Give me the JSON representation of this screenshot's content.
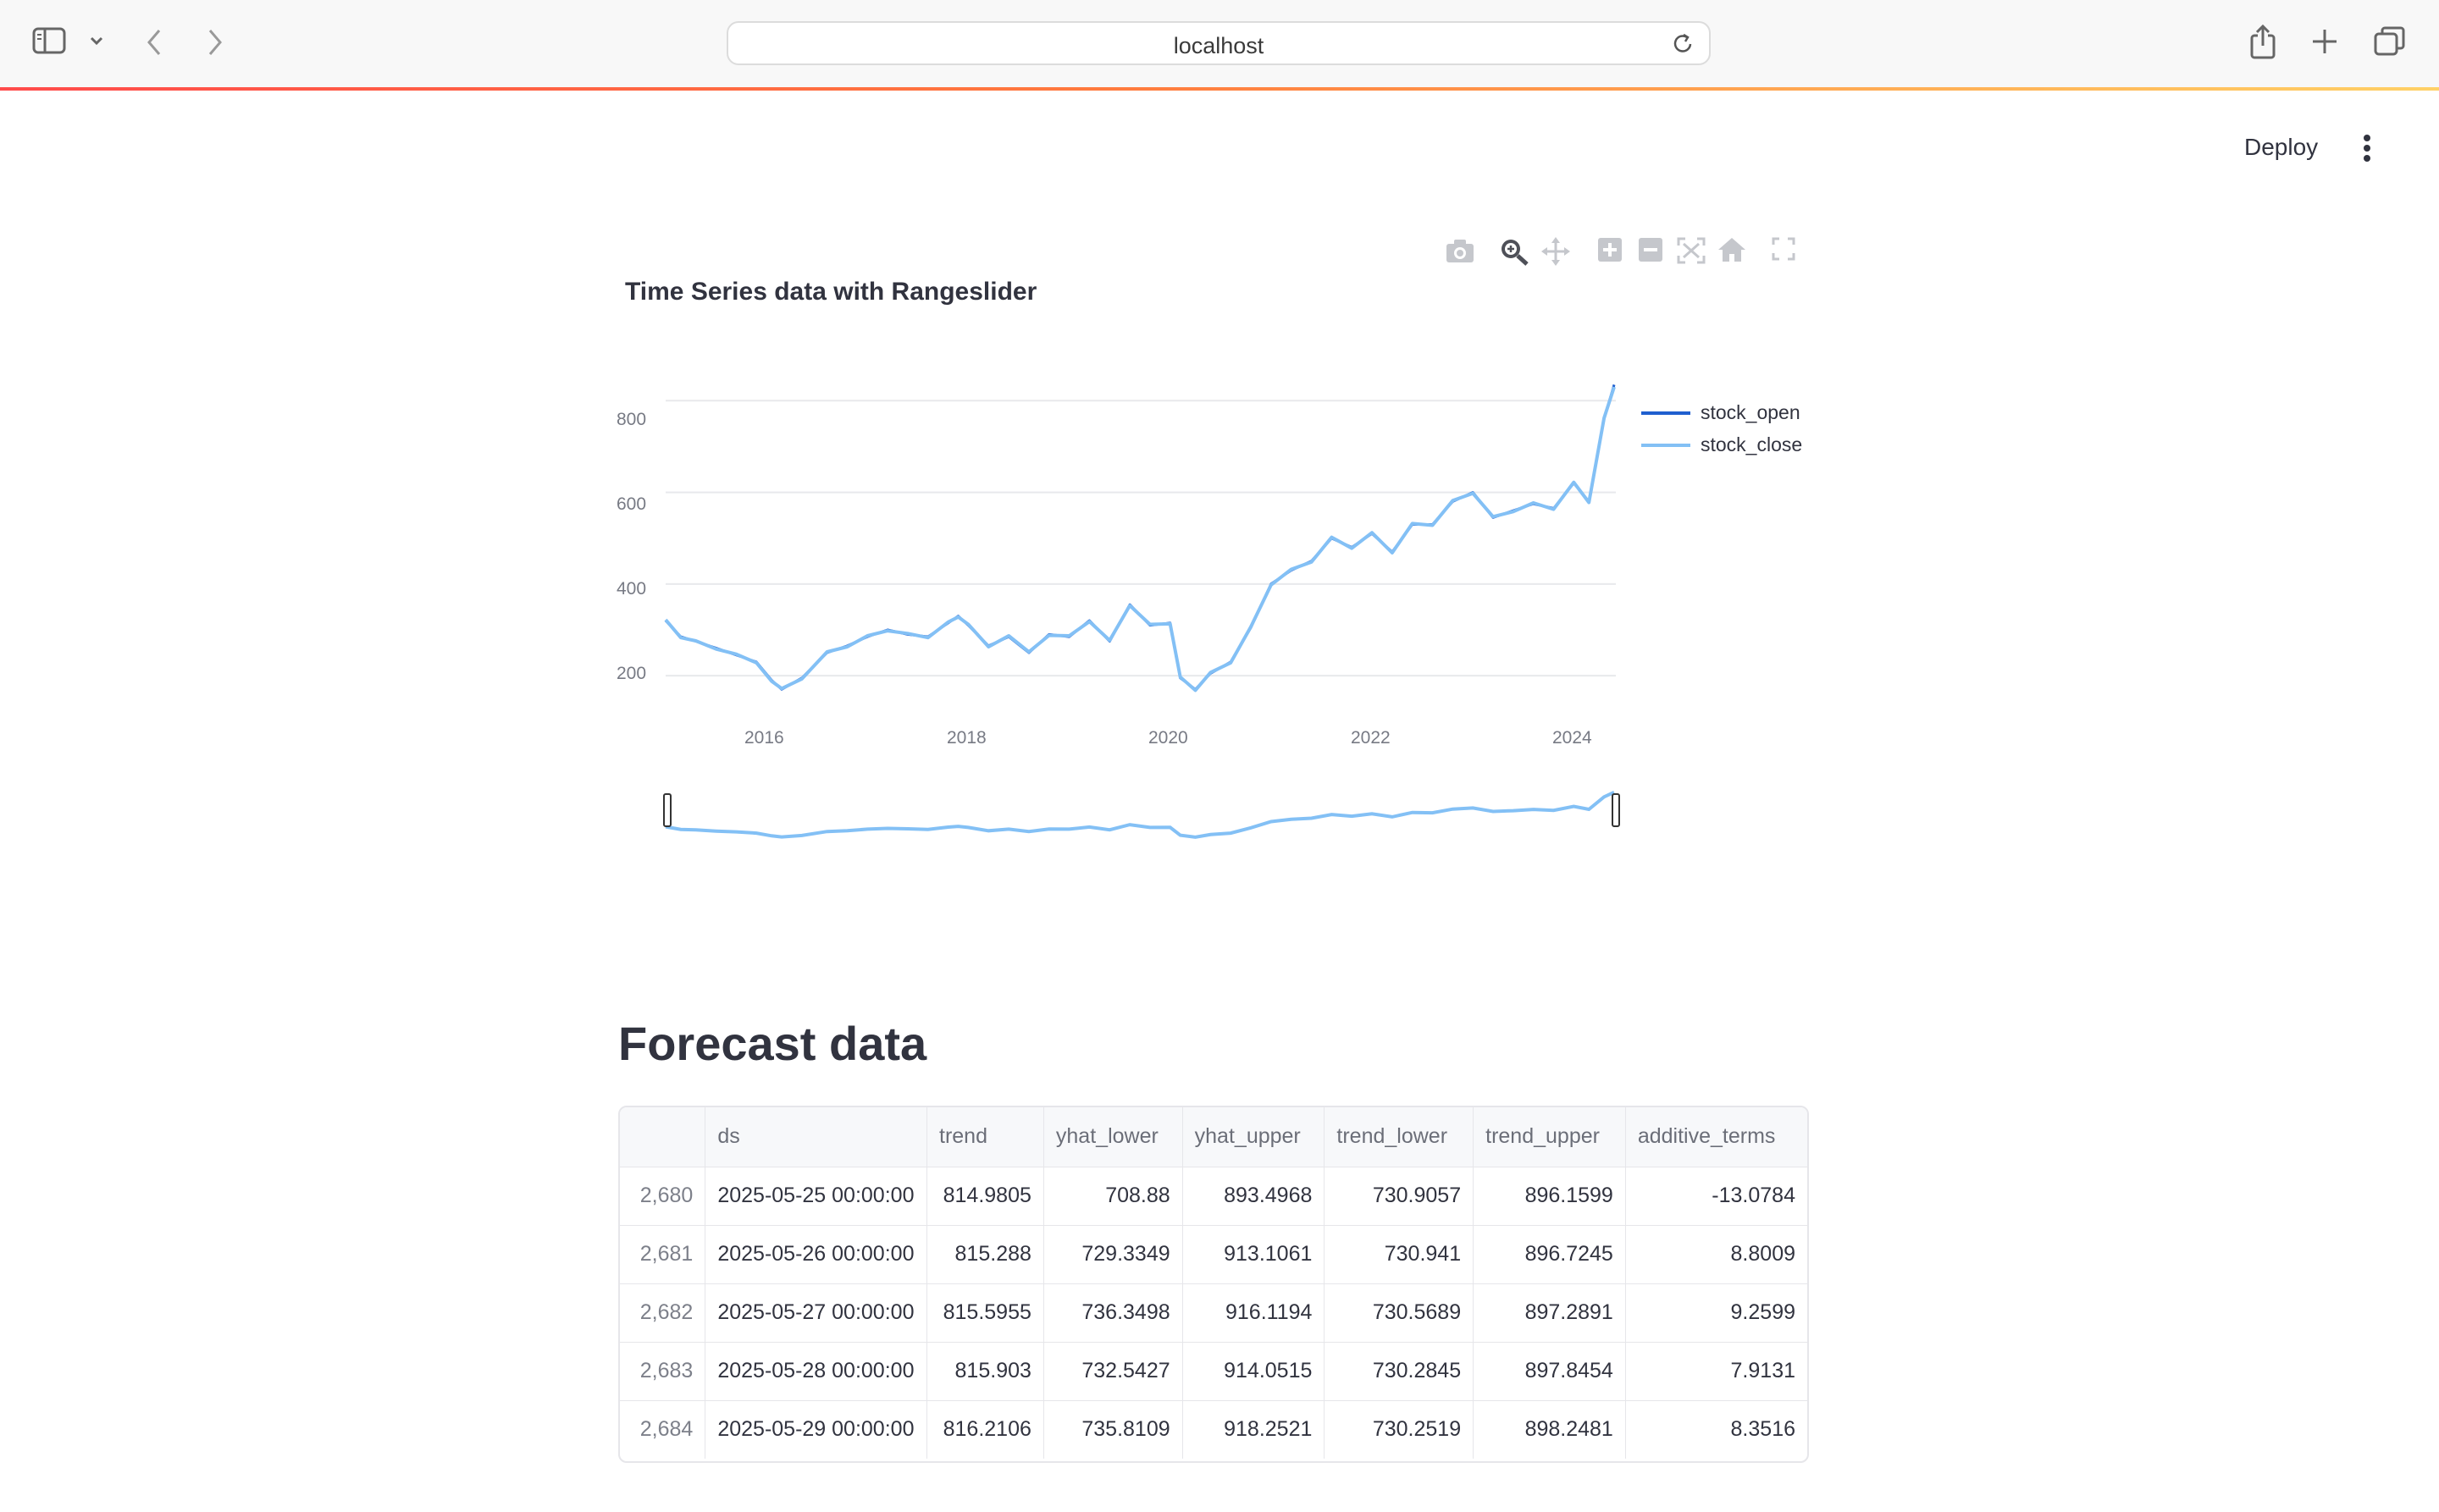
{
  "browser": {
    "url": "localhost"
  },
  "header": {
    "deploy_label": "Deploy"
  },
  "chart_data": {
    "type": "line",
    "title": "Time Series data with Rangeslider",
    "xlabel": "",
    "ylabel": "",
    "x_ticks": [
      "2016",
      "2018",
      "2020",
      "2022",
      "2024"
    ],
    "y_ticks": [
      "200",
      "400",
      "600",
      "800"
    ],
    "xlim": [
      2015.0,
      2024.4
    ],
    "ylim": [
      130,
      880
    ],
    "rangeslider": true,
    "legend": "right",
    "series": [
      {
        "name": "stock_open",
        "color": "#1f5fcf"
      },
      {
        "name": "stock_close",
        "color": "#83c0f5"
      }
    ],
    "x": [
      2015.0,
      2015.15,
      2015.3,
      2015.5,
      2015.7,
      2015.9,
      2016.05,
      2016.15,
      2016.35,
      2016.6,
      2016.8,
      2017.0,
      2017.2,
      2017.4,
      2017.6,
      2017.8,
      2017.9,
      2018.0,
      2018.2,
      2018.4,
      2018.6,
      2018.8,
      2019.0,
      2019.2,
      2019.4,
      2019.6,
      2019.8,
      2020.0,
      2020.1,
      2020.25,
      2020.4,
      2020.6,
      2020.8,
      2021.0,
      2021.2,
      2021.4,
      2021.6,
      2021.8,
      2022.0,
      2022.2,
      2022.4,
      2022.6,
      2022.8,
      2023.0,
      2023.2,
      2023.4,
      2023.6,
      2023.8,
      2024.0,
      2024.15,
      2024.3,
      2024.4
    ],
    "stock_open": [
      320,
      285,
      275,
      260,
      245,
      230,
      190,
      170,
      195,
      250,
      265,
      285,
      300,
      290,
      285,
      315,
      330,
      310,
      265,
      285,
      250,
      290,
      285,
      320,
      275,
      355,
      310,
      315,
      195,
      170,
      205,
      230,
      305,
      400,
      430,
      450,
      500,
      480,
      510,
      470,
      530,
      530,
      580,
      600,
      545,
      560,
      575,
      565,
      620,
      580,
      760,
      835
    ],
    "stock_close": [
      322,
      283,
      276,
      258,
      247,
      228,
      188,
      172,
      193,
      252,
      263,
      287,
      298,
      292,
      283,
      317,
      328,
      312,
      263,
      287,
      252,
      288,
      287,
      318,
      277,
      353,
      312,
      313,
      197,
      168,
      207,
      228,
      307,
      398,
      432,
      448,
      502,
      478,
      512,
      468,
      532,
      528,
      582,
      598,
      547,
      558,
      577,
      563,
      622,
      578,
      762,
      830
    ]
  },
  "forecast": {
    "title": "Forecast data",
    "columns": [
      "",
      "ds",
      "trend",
      "yhat_lower",
      "yhat_upper",
      "trend_lower",
      "trend_upper",
      "additive_terms"
    ],
    "rows": [
      [
        "2,680",
        "2025-05-25 00:00:00",
        "814.9805",
        "708.88",
        "893.4968",
        "730.9057",
        "896.1599",
        "-13.0784"
      ],
      [
        "2,681",
        "2025-05-26 00:00:00",
        "815.288",
        "729.3349",
        "913.1061",
        "730.941",
        "896.7245",
        "8.8009"
      ],
      [
        "2,682",
        "2025-05-27 00:00:00",
        "815.5955",
        "736.3498",
        "916.1194",
        "730.5689",
        "897.2891",
        "9.2599"
      ],
      [
        "2,683",
        "2025-05-28 00:00:00",
        "815.903",
        "732.5427",
        "914.0515",
        "730.2845",
        "897.8454",
        "7.9131"
      ],
      [
        "2,684",
        "2025-05-29 00:00:00",
        "816.2106",
        "735.8109",
        "918.2521",
        "730.2519",
        "898.2481",
        "8.3516"
      ]
    ]
  }
}
